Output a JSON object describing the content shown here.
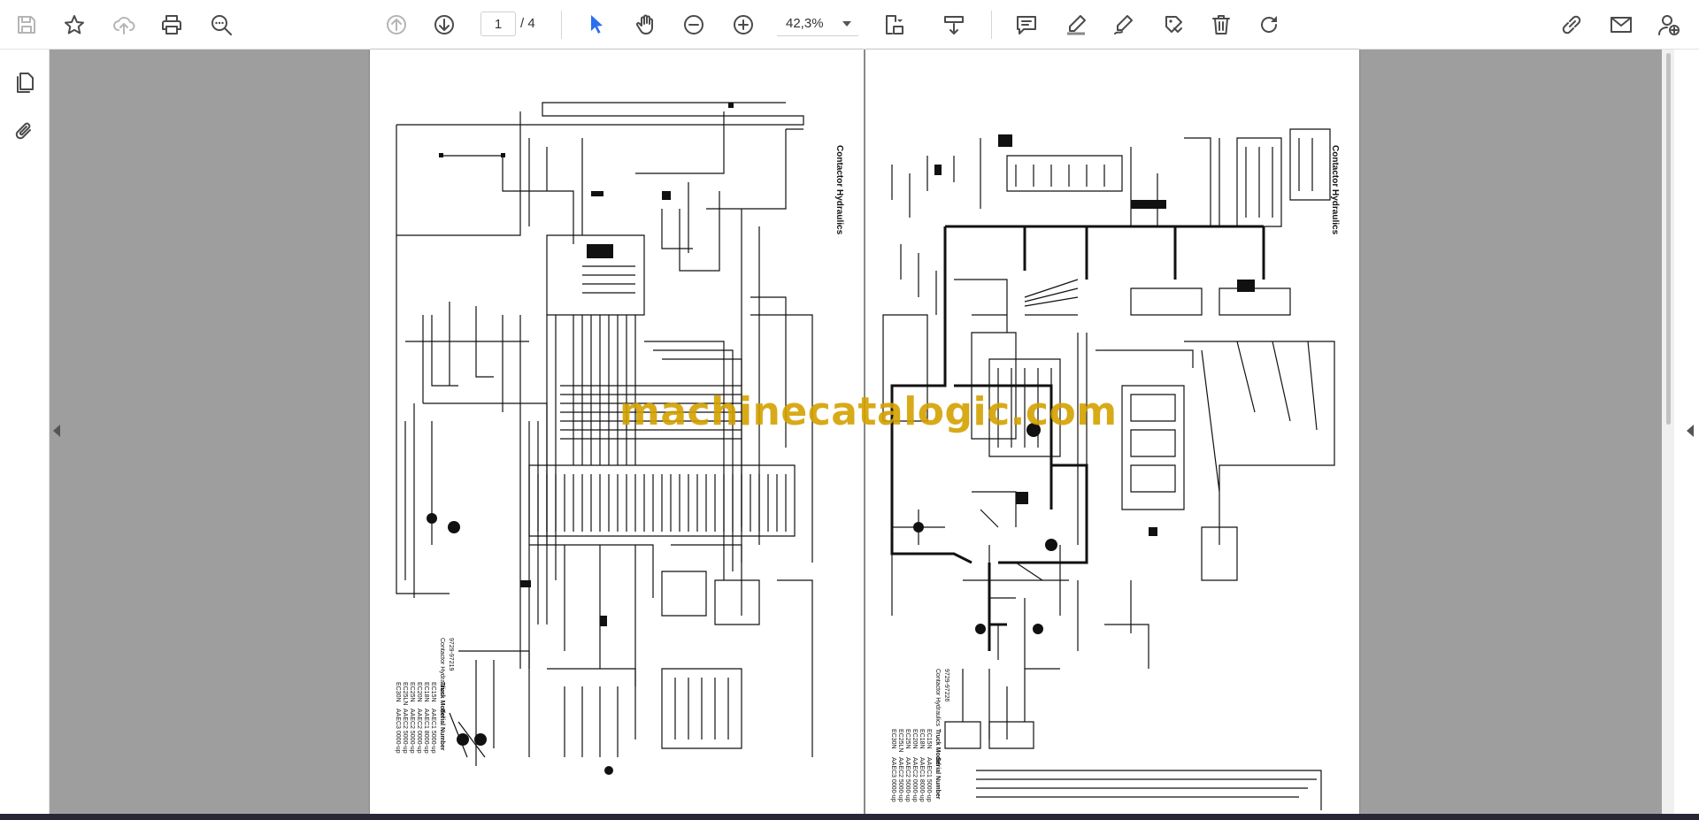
{
  "toolbar": {
    "current_page": "1",
    "page_total": "/ 4",
    "zoom": "42,3%",
    "icons": [
      "save-icon",
      "bookmark-star-icon",
      "cloud-upload-icon",
      "print-icon",
      "zoom-search-icon",
      "previous-page-icon",
      "next-page-icon",
      "select-cursor-icon",
      "hand-tool-icon",
      "zoom-out-icon",
      "zoom-in-icon",
      "fit-page-icon",
      "scroll-mode-icon",
      "comment-icon",
      "highlight-pen-icon",
      "draw-pen-icon",
      "stamp-icon",
      "delete-icon",
      "rotate-icon",
      "share-link-icon",
      "email-icon",
      "add-user-icon"
    ]
  },
  "leftpane": {
    "icons": [
      "pages-thumbnails-icon",
      "attachments-paperclip-icon"
    ]
  },
  "document": {
    "watermark": "machinecatalogic.com",
    "page_left": {
      "title": "Contactor Hydraulics",
      "model_code": "9729-97219",
      "model_label": "Contactor Hydraulics",
      "table_header_model": "Truck Model",
      "table_header_serial": "Serial Number",
      "models": [
        "EC15N",
        "EC18N",
        "EC20N",
        "EC25N",
        "EC25LN",
        "EC30N"
      ],
      "serials": [
        "AAEC1 5000-up",
        "AAEC1 8000-up",
        "AAEC2 0000-up",
        "AAEC2 5000-up",
        "AAEC2 5000-up",
        "AAEC3 0000-up"
      ]
    },
    "page_right": {
      "title": "Contactor Hydraulics",
      "model_code": "9729-97226",
      "model_label": "Contactor Hydraulics",
      "table_header_model": "Truck Model",
      "table_header_serial": "Serial Number",
      "models": [
        "EC15N",
        "EC18N",
        "EC20N",
        "EC25N",
        "EC25LN",
        "EC30N"
      ],
      "serials": [
        "AAEC1 5000-up",
        "AAEC1 8000-up",
        "AAEC2 0000-up",
        "AAEC2 5000-up",
        "AAEC2 5000-up",
        "AAEC3 0000-up"
      ]
    }
  },
  "colors": {
    "toolbar_icon": "#4b4b4b",
    "toolbar_icon_disabled": "#b5b5b5",
    "select_tool_active": "#2a6ff0",
    "document_background": "#9e9e9e",
    "watermark": "#d4a100"
  }
}
